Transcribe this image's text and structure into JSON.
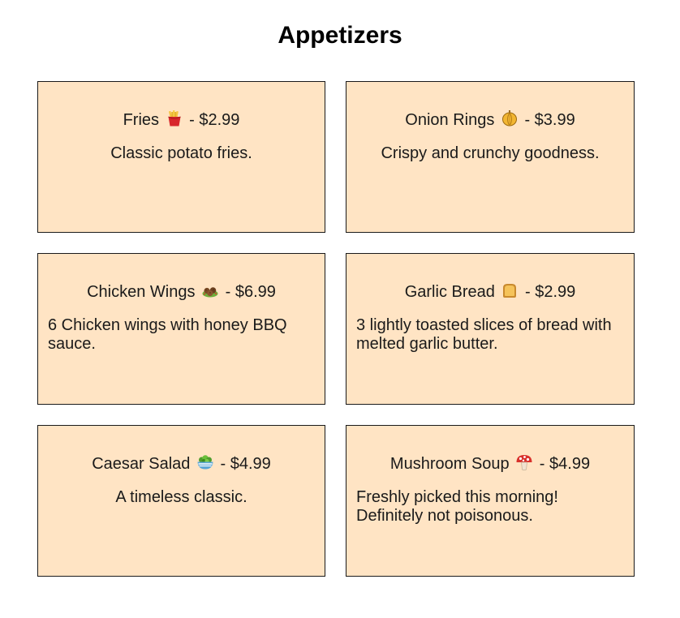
{
  "page": {
    "title": "Appetizers"
  },
  "menu": {
    "items": [
      {
        "name": "Fries",
        "icon": "fries-icon",
        "price": "$2.99",
        "description": "Classic potato fries."
      },
      {
        "name": "Onion Rings",
        "icon": "onion-icon",
        "price": "$3.99",
        "description": "Crispy and crunchy goodness."
      },
      {
        "name": "Chicken Wings",
        "icon": "falafel-icon",
        "price": "$6.99",
        "description": "6 Chicken wings with honey BBQ sauce."
      },
      {
        "name": "Garlic Bread",
        "icon": "bread-icon",
        "price": "$2.99",
        "description": "3 lightly toasted slices of bread with melted garlic butter."
      },
      {
        "name": "Caesar Salad",
        "icon": "salad-icon",
        "price": "$4.99",
        "description": "A timeless classic."
      },
      {
        "name": "Mushroom Soup",
        "icon": "mushroom-icon",
        "price": "$4.99",
        "description": "Freshly picked this morning! Definitely not poisonous."
      }
    ]
  },
  "colors": {
    "card_background": "#ffe4c4",
    "card_border": "#1a1a1a"
  }
}
